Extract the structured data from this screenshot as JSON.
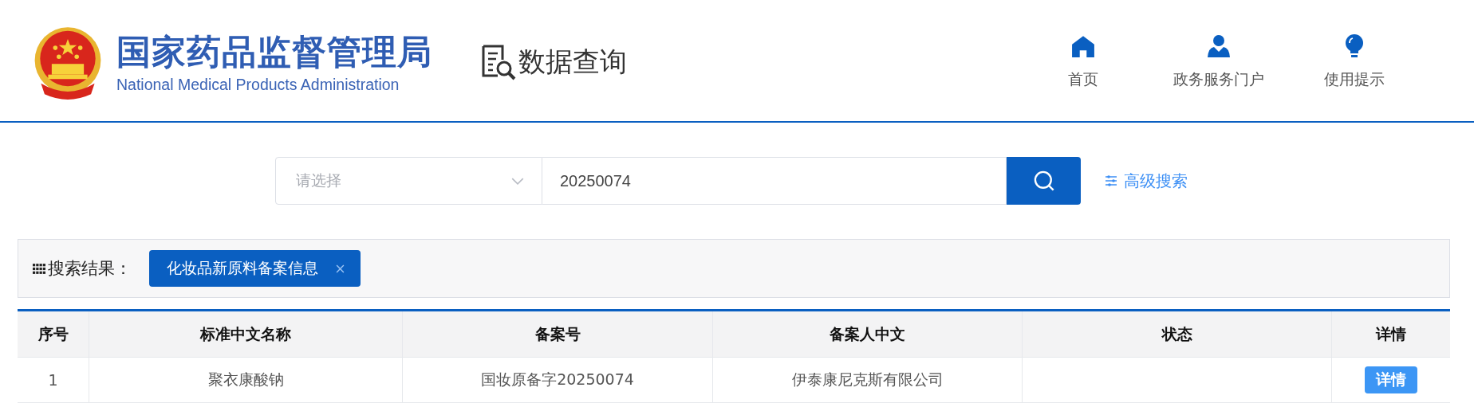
{
  "header": {
    "title": "国家药品监督管理局",
    "subtitle": "National Medical Products Administration",
    "section": "数据查询",
    "nav": [
      {
        "kind": "home",
        "label": "首页"
      },
      {
        "kind": "person",
        "label": "政务服务门户"
      },
      {
        "kind": "bulb",
        "label": "使用提示"
      }
    ]
  },
  "search": {
    "select": {
      "placeholder": "请选择"
    },
    "query": "20250074",
    "advanced": "高级搜索"
  },
  "results": {
    "label": "搜索结果：",
    "tag": "化妆品新原料备案信息"
  },
  "table": {
    "columns": [
      "序号",
      "标准中文名称",
      "备案号",
      "备案人中文",
      "状态",
      "详情"
    ],
    "rows": [
      {
        "cells": [
          "1",
          "聚衣康酸钠",
          "国妆原备字20250074",
          "伊泰康尼克斯有限公司"
        ],
        "action": "详情"
      }
    ]
  }
}
